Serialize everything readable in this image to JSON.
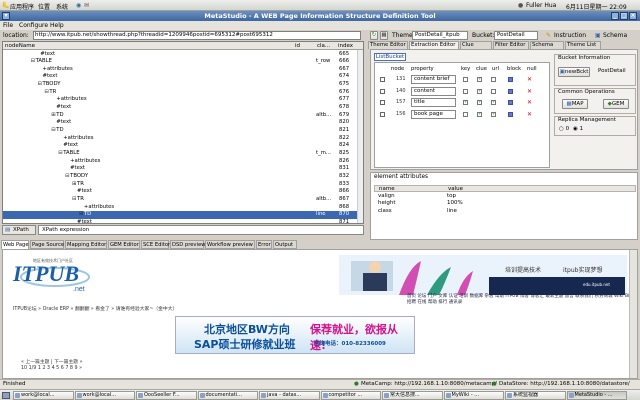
{
  "top_panel": {
    "apps": "应用程序",
    "places": "位置",
    "system": "系统",
    "user": "Fuller Hua",
    "datetime": "6月11日星期一 22:09"
  },
  "window": {
    "title": "MetaStudio - A WEB Page Information Structure Definition Tool"
  },
  "menu": {
    "file": "File",
    "configure": "Configure",
    "help": "Help"
  },
  "location": {
    "label": "location:",
    "url": "http://www.itpub.net/showthread.php?threadid=1209946postid=695312#post695312"
  },
  "theme_bar": {
    "theme_label": "Theme:",
    "theme_value": "PostDetail_itpub",
    "bucket_label": "Bucket:",
    "bucket_value": "PostDetail",
    "instruction_btn": "Instruction",
    "schema_btn": "Schema"
  },
  "tree": {
    "headers": {
      "node": "nodeName",
      "id": "id",
      "cls": "cla...",
      "index": "index"
    },
    "rows": [
      {
        "label": "#text",
        "type": "",
        "index": "665",
        "indent": 14,
        "tog": ""
      },
      {
        "label": "TABLE",
        "type": "t_row",
        "index": "666",
        "indent": 12,
        "tog": "−"
      },
      {
        "label": "+attributes",
        "type": "",
        "index": "667",
        "indent": 15,
        "tog": ""
      },
      {
        "label": "#text",
        "type": "",
        "index": "674",
        "indent": 15,
        "tog": ""
      },
      {
        "label": "TBODY",
        "type": "",
        "index": "675",
        "indent": 15,
        "tog": "−"
      },
      {
        "label": "TR",
        "type": "",
        "index": "676",
        "indent": 18,
        "tog": "−"
      },
      {
        "label": "+attributes",
        "type": "",
        "index": "677",
        "indent": 21,
        "tog": ""
      },
      {
        "label": "#text",
        "type": "",
        "index": "678",
        "indent": 21,
        "tog": ""
      },
      {
        "label": "TD",
        "type": "altb...",
        "index": "679",
        "indent": 21,
        "tog": "+"
      },
      {
        "label": "#text",
        "type": "",
        "index": "820",
        "indent": 21,
        "tog": ""
      },
      {
        "label": "TD",
        "type": "",
        "index": "821",
        "indent": 21,
        "tog": "−"
      },
      {
        "label": "+attributes",
        "type": "",
        "index": "822",
        "indent": 24,
        "tog": ""
      },
      {
        "label": "#text",
        "type": "",
        "index": "824",
        "indent": 24,
        "tog": ""
      },
      {
        "label": "TABLE",
        "type": "t_m...",
        "index": "825",
        "indent": 24,
        "tog": "−"
      },
      {
        "label": "+attributes",
        "type": "",
        "index": "826",
        "indent": 27,
        "tog": ""
      },
      {
        "label": "#text",
        "type": "",
        "index": "831",
        "indent": 27,
        "tog": ""
      },
      {
        "label": "TBODY",
        "type": "",
        "index": "832",
        "indent": 27,
        "tog": "−"
      },
      {
        "label": "TR",
        "type": "",
        "index": "833",
        "indent": 30,
        "tog": "+"
      },
      {
        "label": "#text",
        "type": "",
        "index": "866",
        "indent": 30,
        "tog": ""
      },
      {
        "label": "TR",
        "type": "altb...",
        "index": "867",
        "indent": 30,
        "tog": "−"
      },
      {
        "label": "+attributes",
        "type": "",
        "index": "868",
        "indent": 33,
        "tog": ""
      },
      {
        "label": "TD",
        "type": "line",
        "index": "870",
        "indent": 33,
        "tog": "+",
        "selected": true
      },
      {
        "label": "#text",
        "type": "",
        "index": "871",
        "indent": 30,
        "tog": ""
      }
    ]
  },
  "xpath": {
    "button": "XPath",
    "expression": "XPath expression"
  },
  "right_tabs": [
    "Theme Editor",
    "Extraction Editor",
    "Clue Editor",
    "Filter Editor",
    "Schema List",
    "Theme List"
  ],
  "bucket_editor": {
    "tab": "ListBucket",
    "headers": {
      "node": "node",
      "property": "property",
      "key": "key",
      "clue": "clue",
      "url": "url",
      "block": "block",
      "null": "null"
    },
    "rows": [
      {
        "num": "131",
        "property": "content brief",
        "key": false,
        "clue": true,
        "url": false,
        "block": true,
        "null": true
      },
      {
        "num": "140",
        "property": "content",
        "key": false,
        "clue": true,
        "url": false,
        "block": true,
        "null": true
      },
      {
        "num": "157",
        "property": "title",
        "key": true,
        "clue": true,
        "url": true,
        "block": true,
        "null": true
      },
      {
        "num": "156",
        "property": "book page",
        "key": false,
        "clue": true,
        "url": true,
        "block": true,
        "null": true
      }
    ],
    "bucket_info": {
      "title": "Bucket Information",
      "new_btn": "newBckt",
      "name": "PostDetail"
    },
    "common_ops": {
      "title": "Common Operations",
      "map": "MAP",
      "gem": "GEM"
    },
    "replica": {
      "title": "Replica Management",
      "opt0": "0",
      "opt1": "1"
    }
  },
  "attributes": {
    "title": "element attributes",
    "headers": {
      "name": "name",
      "value": "value"
    },
    "rows": [
      {
        "name": "valign",
        "value": "top"
      },
      {
        "name": "height",
        "value": "100%"
      },
      {
        "name": "class",
        "value": "line"
      }
    ]
  },
  "lower_tabs": [
    "Web Page",
    "Page Source",
    "Mapping Editor",
    "GEM Editor",
    "SCE Editor",
    "DSD preview",
    "Workflow preview",
    "Error",
    "Output"
  ],
  "webpage": {
    "logo_text": "ITPUB",
    "logo_net": ".net",
    "logo_slogan": "地区有效技术门户社区",
    "banner1_text": "培训提高技术",
    "banner1_text2": "itpub实现梦想",
    "banner1_sub": "edu.itpub.net",
    "nav_links": "首页 论坛 门户 文库 认证 培训 数据库 杂志 帮助 ITPUB 博客 博客汇 最新主题 留言 联系我们 积分商城 Wiki Blog 招聘 在线 帮助 排行 通讯录",
    "breadcrumb": "ITPUB论坛 » Oracle ERP » 翻翻翻 » 看金了 » 请谁有经验大家~（金中大）",
    "banner2_l1": "北京地区BW方向",
    "banner2_l2": "SAP硕士研修就业班",
    "banner2_r1": "保荐就业，欲报从速!",
    "banner2_phone": "咨询电话：010-82336009",
    "pager": "« 上一篇主题 | 下一篇主题 »",
    "pager2": "10  1/9  1 2 3 4 5 6 7 8 9 »"
  },
  "status": {
    "left": "Finished",
    "metacamp": "MetaCamp: http://192.168.1.10:8080/metacamp/",
    "datastore": "DataStore: http://192.168.1.10:8080/datastore/"
  },
  "taskbar": [
    "work@local...",
    "work@local...",
    "OooSeeller F...",
    "documentati...",
    "java - datas...",
    "competitor ...",
    "常大信息搜...",
    "MyWiki - ...",
    "系统监视器",
    "MetaStudio - ..."
  ]
}
